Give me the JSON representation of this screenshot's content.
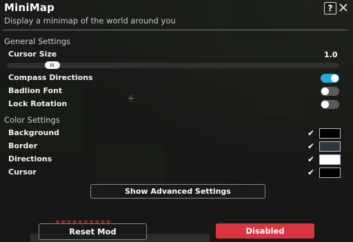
{
  "header": {
    "title": "MiniMap",
    "subtitle": "Display a minimap of the world around you",
    "help_label": "?",
    "close_label": "✕"
  },
  "general": {
    "section_title": "General Settings",
    "cursor_size": {
      "label": "Cursor Size",
      "value": "1.0",
      "slider_fraction": 0.12
    },
    "compass_directions": {
      "label": "Compass Directions",
      "enabled": true
    },
    "badlion_font": {
      "label": "Badlion Font",
      "enabled": false
    },
    "lock_rotation": {
      "label": "Lock Rotation",
      "enabled": false
    }
  },
  "colors": {
    "section_title": "Color Settings",
    "items": [
      {
        "label": "Background",
        "checked": true,
        "color": "#000000"
      },
      {
        "label": "Border",
        "checked": true,
        "color": "#2e3440"
      },
      {
        "label": "Directions",
        "checked": true,
        "color": "#ffffff"
      },
      {
        "label": "Cursor",
        "checked": true,
        "color": "#000000"
      }
    ]
  },
  "advanced_button": "Show Advanced Settings",
  "footer": {
    "reset_label": "Reset Mod",
    "status_label": "Disabled"
  },
  "theme": {
    "accent": "#29a8df",
    "danger": "#d9343f"
  }
}
